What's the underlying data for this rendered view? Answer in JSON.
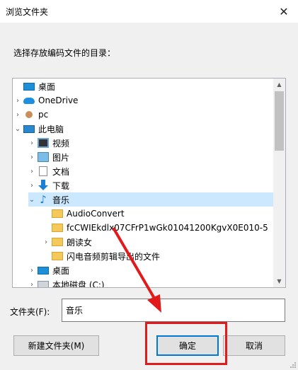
{
  "window": {
    "title": "浏览文件夹",
    "close_glyph": "✕"
  },
  "prompt": "选择存放编码文件的目录：",
  "tree": {
    "items": [
      {
        "label": "桌面",
        "icon": "desktop-icon",
        "expander": ""
      },
      {
        "label": "OneDrive",
        "icon": "onedrive-icon",
        "expander": "›"
      },
      {
        "label": "pc",
        "icon": "user-icon",
        "expander": "›"
      },
      {
        "label": "此电脑",
        "icon": "pc-icon",
        "expander": "⌄"
      },
      {
        "label": "视频",
        "icon": "video-icon",
        "expander": "›"
      },
      {
        "label": "图片",
        "icon": "pictures-icon",
        "expander": "›"
      },
      {
        "label": "文档",
        "icon": "documents-icon",
        "expander": "›"
      },
      {
        "label": "下载",
        "icon": "download-icon",
        "expander": "›"
      },
      {
        "label": "音乐",
        "icon": "music-icon",
        "expander": "⌄",
        "selected": true
      },
      {
        "label": "AudioConvert",
        "icon": "folder-icon",
        "expander": ""
      },
      {
        "label": "fcCWIEkdlx07CFrP1wGk01041200KgvX0E010-5",
        "icon": "folder-icon",
        "expander": ""
      },
      {
        "label": "朗读女",
        "icon": "folder-icon",
        "expander": "›"
      },
      {
        "label": "闪电音频剪辑导出的文件",
        "icon": "folder-icon",
        "expander": ""
      },
      {
        "label": "桌面",
        "icon": "desktop-icon",
        "expander": "›"
      },
      {
        "label": "本地磁盘 (C:)",
        "icon": "drive-icon",
        "expander": "›"
      }
    ]
  },
  "folder_field": {
    "label": "文件夹(F):",
    "value": "音乐"
  },
  "buttons": {
    "new_folder": "新建文件夹(M)",
    "ok": "确定",
    "cancel": "取消"
  },
  "colors": {
    "annotation": "#e11b1b",
    "selection": "#cce8ff",
    "default_button_border": "#0078d7"
  }
}
